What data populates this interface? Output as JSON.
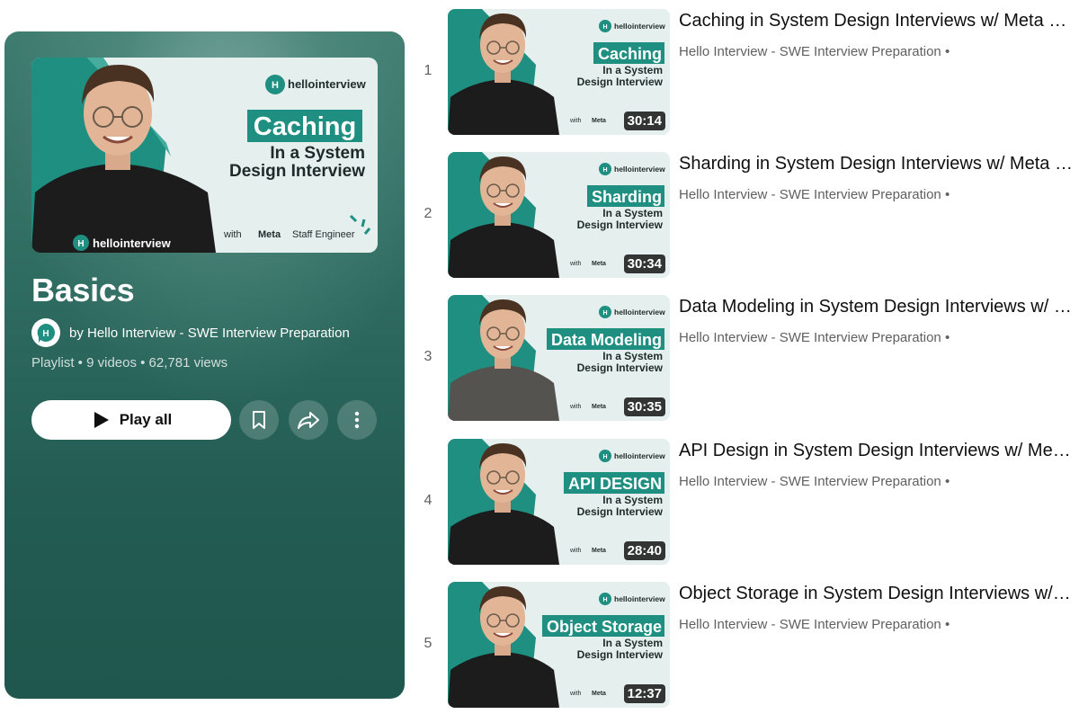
{
  "playlist": {
    "title": "Basics",
    "owner": "by Hello Interview - SWE Interview Preparation",
    "stats": "Playlist • 9 videos • 62,781 views",
    "play_all_label": "Play all",
    "hero": {
      "brand": "hellointerview",
      "topic": "Caching",
      "line2": "In a System",
      "line3": "Design Interview",
      "footer_with": "with",
      "footer_meta": "Meta",
      "footer_role": "Staff Engineer"
    }
  },
  "icons": {
    "play": "play-icon",
    "save": "bookmark-icon",
    "share": "share-icon",
    "more": "more-vert-icon",
    "avatar": "hello-interview-logo"
  },
  "colors": {
    "accent_teal": "#1e8f80",
    "panel_bg": "#2e6b60"
  },
  "thumb_text": {
    "brand": "hellointerview",
    "line2": "In a System",
    "line3": "Design Interview",
    "with": "with",
    "meta": "Meta"
  },
  "videos": [
    {
      "index": "1",
      "title": "Caching in System Design Interviews w/ Meta Staff Engineer",
      "channel": "Hello Interview - SWE Interview Preparation •",
      "duration": "30:14",
      "thumb_topic": "Caching"
    },
    {
      "index": "2",
      "title": "Sharding in System Design Interviews w/ Meta Staff Engineer",
      "channel": "Hello Interview - SWE Interview Preparation •",
      "duration": "30:34",
      "thumb_topic": "Sharding"
    },
    {
      "index": "3",
      "title": "Data Modeling in System Design Interviews w/ Meta Staff Engineer",
      "channel": "Hello Interview - SWE Interview Preparation •",
      "duration": "30:35",
      "thumb_topic": "Data Modeling"
    },
    {
      "index": "4",
      "title": "API Design in System Design Interviews w/ Meta Staff Engineer",
      "channel": "Hello Interview - SWE Interview Preparation •",
      "duration": "28:40",
      "thumb_topic": "API DESIGN"
    },
    {
      "index": "5",
      "title": "Object Storage in System Design Interviews w/ Meta Staff Engineer",
      "channel": "Hello Interview - SWE Interview Preparation •",
      "duration": "12:37",
      "thumb_topic": "Object Storage"
    }
  ]
}
